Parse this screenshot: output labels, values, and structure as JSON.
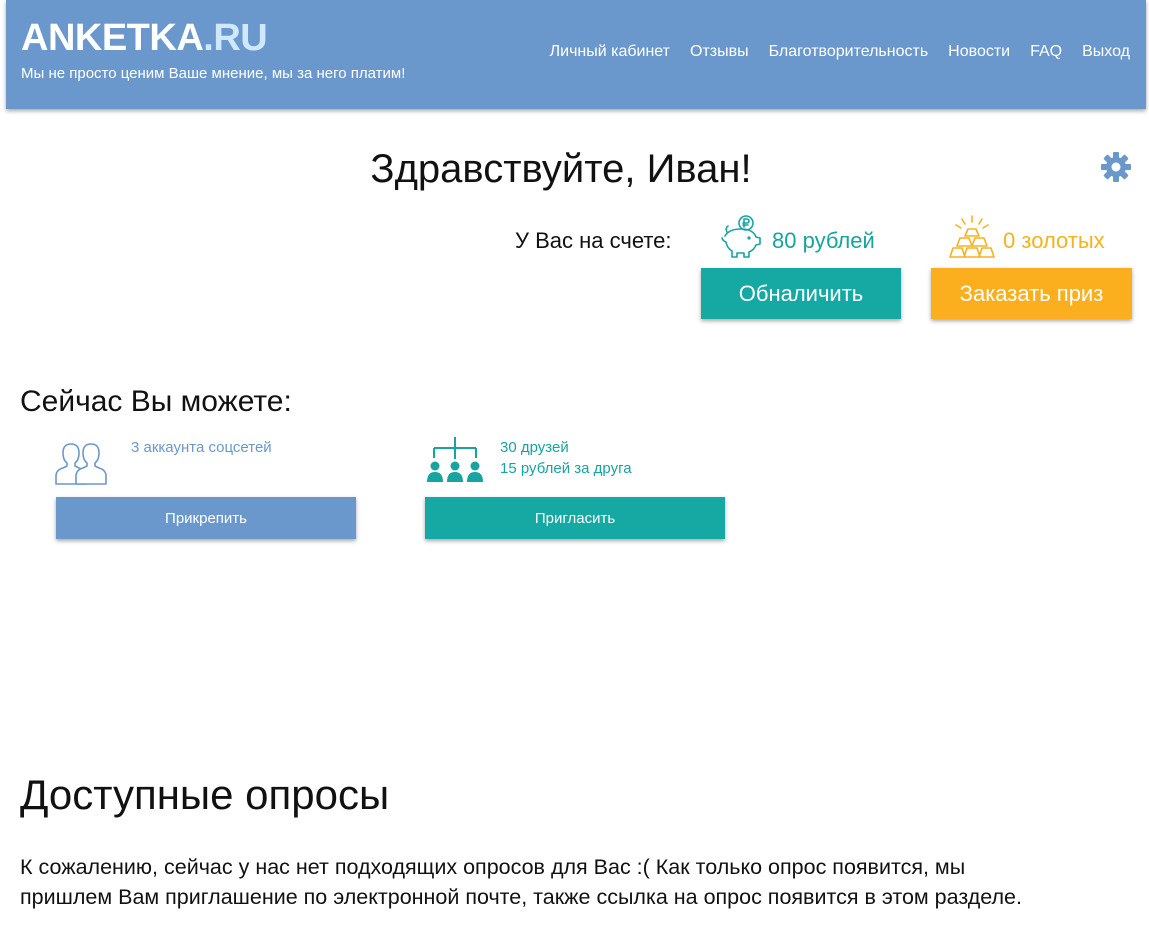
{
  "header": {
    "logo_main": "ANKETKA",
    "logo_dot": ".",
    "logo_tld": "RU",
    "tagline": "Мы не просто ценим Ваше мнение, мы за него платим!",
    "nav": [
      "Личный кабинет",
      "Отзывы",
      "Благотворительность",
      "Новости",
      "FAQ",
      "Выход"
    ]
  },
  "greeting": "Здравствуйте, Иван!",
  "settings_icon": "gear-icon",
  "balance": {
    "label": "У Вас на счете:",
    "rubles": "80 рублей",
    "rubles_icon": "piggy-bank-ruble-icon",
    "gold": "0 золотых",
    "gold_icon": "gold-bars-icon",
    "cash_button": "Обналичить",
    "prize_button": "Заказать приз"
  },
  "now": {
    "title": "Сейчас Вы можете:",
    "social": {
      "icon": "people-icon",
      "text": "3 аккаунта соцсетей",
      "button": "Прикрепить"
    },
    "friends": {
      "icon": "referral-tree-icon",
      "line1": "30 друзей",
      "line2": "15 рублей за друга",
      "button": "Пригласить"
    }
  },
  "surveys": {
    "title": "Доступные опросы",
    "line1": "К сожалению, сейчас у нас нет подходящих опросов для Вас :( Как только опрос появится, мы",
    "line2": "пришлем Вам приглашение по электронной почте, также ссылка на опрос появится в этом разделе."
  },
  "colors": {
    "header_blue": "#6b98cc",
    "teal": "#16a8a2",
    "orange": "#fbaf1e",
    "gold_text": "#f5b21e"
  }
}
